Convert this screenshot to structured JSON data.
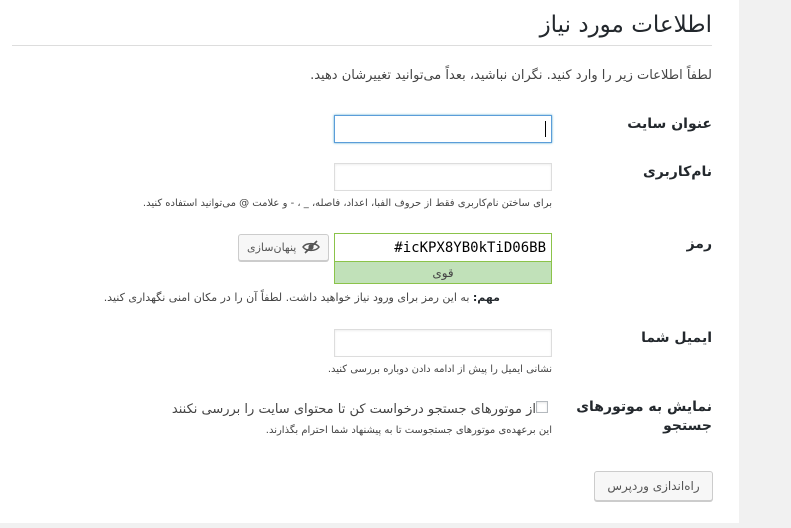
{
  "page": {
    "title": "اطلاعات مورد نیاز",
    "intro": "لطفاً اطلاعات زیر را وارد کنید. نگران نباشید، بعداً می‌توانید تغییرشان دهید."
  },
  "site_title": {
    "label": "عنوان سایت",
    "value": ""
  },
  "username": {
    "label": "نام‌کاربری",
    "value": "",
    "description": "برای ساختن نام‌کاربری فقط از حروف الفبا، اعداد، فاصله، _ ، - و علامت @ می‌توانید استفاده کنید."
  },
  "password": {
    "label": "رمز",
    "value": "#icKPX8YB0kTiD06BB",
    "strength": "قوی",
    "hide_label": "پنهان‌سازی",
    "important_prefix": "مهم:",
    "important_text": "به این رمز برای ورود نیاز خواهید داشت. لطفاً آن را در مکان امنی نگهداری کنید."
  },
  "email": {
    "label": "ایمیل شما",
    "value": "",
    "description": "نشانی ایمیل را پیش از ادامه دادن دوباره بررسی کنید."
  },
  "search_visibility": {
    "label_line1": "نمایش به موتورهای",
    "label_line2": "جستجو",
    "checkbox_label": "از موتورهای جستجو درخواست کن تا محتوای سایت را بررسی نکنند",
    "checked": false,
    "description": "این برعهده‌ی موتورهای جستجوست تا به پیشنهاد شما احترام بگذارند."
  },
  "submit": {
    "label": "راه‌اندازی وردپرس"
  },
  "colors": {
    "strength_bg": "#c1e1b9",
    "strength_border": "#8bc34a",
    "focus_border": "#5b9dd9"
  },
  "icons": {
    "hide": "eye-slash-icon"
  }
}
